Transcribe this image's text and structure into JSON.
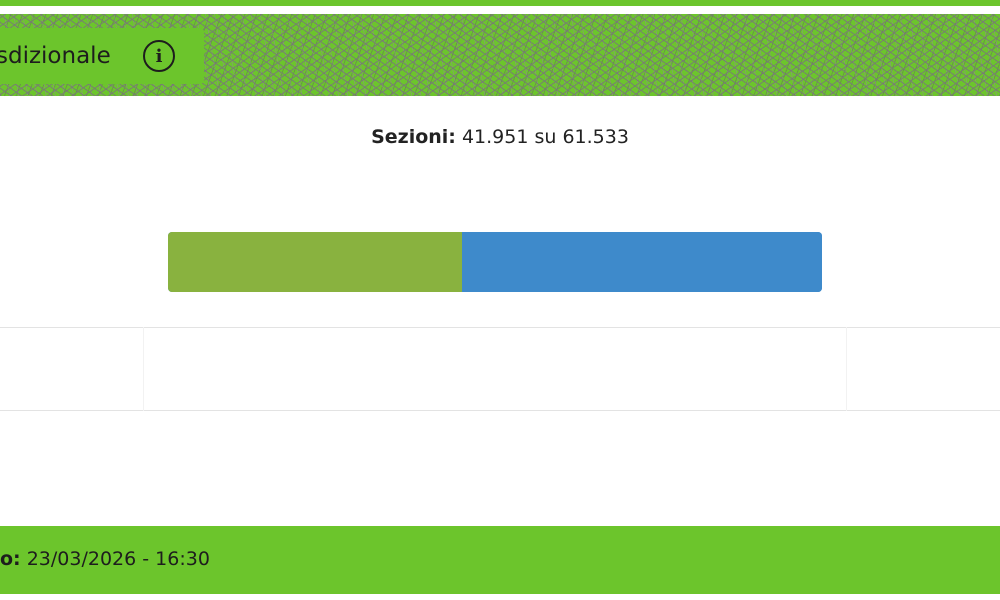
{
  "header": {
    "title": "Affluenza circoscrizionale",
    "visible_title": "sdizionale"
  },
  "sezioni": {
    "label": "Sezioni:",
    "value": "41.951 su 61.533",
    "counted": 41951,
    "total": 61533
  },
  "progress": {
    "fraction": 0.45,
    "colors": {
      "filled": "#89b23f",
      "remaining": "#3e8acb"
    }
  },
  "footer": {
    "label_visible": "o:",
    "value": "23/03/2026 - 16:30"
  },
  "colors": {
    "brand_green": "#6cc52c",
    "pattern_gray": "#787878"
  }
}
